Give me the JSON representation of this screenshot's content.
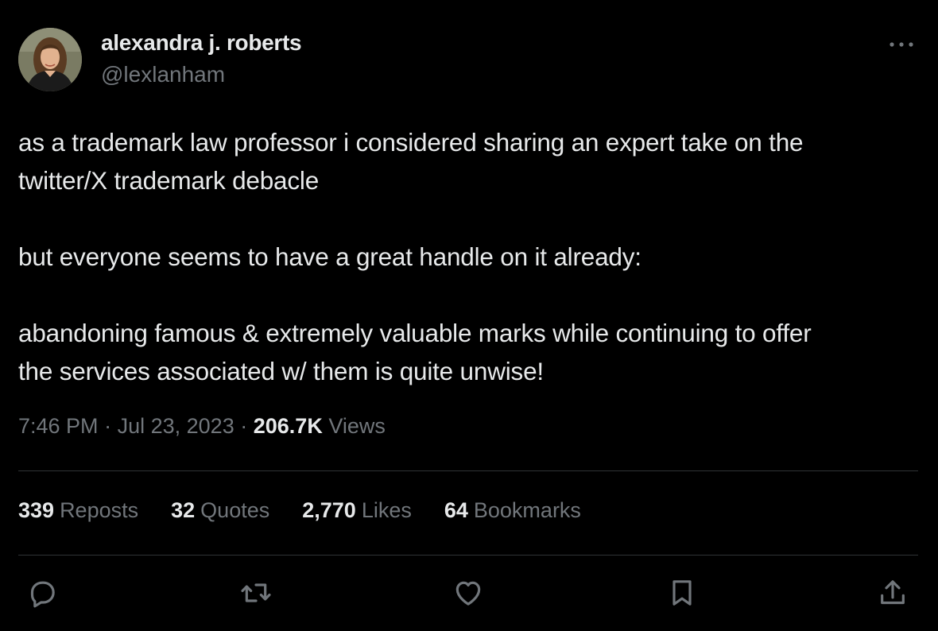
{
  "author": {
    "display_name": "alexandra j. roberts",
    "handle": "@lexlanham",
    "avatar_icon": "profile-photo"
  },
  "tweet": {
    "paragraphs": [
      [
        "as a trademark law professor i considered sharing an expert take on the",
        "twitter/X trademark debacle"
      ],
      [
        "but everyone seems to have a great handle on it already:"
      ],
      [
        "abandoning famous & extremely valuable marks while continuing to offer",
        "the services associated w/ them is quite unwise!"
      ]
    ]
  },
  "meta": {
    "time": "7:46 PM",
    "separator": "·",
    "date": "Jul 23, 2023",
    "views_count": "206.7K",
    "views_label": "Views"
  },
  "stats": {
    "reposts": {
      "count": "339",
      "label": "Reposts"
    },
    "quotes": {
      "count": "32",
      "label": "Quotes"
    },
    "likes": {
      "count": "2,770",
      "label": "Likes"
    },
    "bookmarks": {
      "count": "64",
      "label": "Bookmarks"
    }
  },
  "actions": [
    "reply-icon",
    "repost-icon",
    "like-icon",
    "bookmark-icon",
    "share-icon"
  ],
  "colors": {
    "background": "#000000",
    "text_primary": "#e7e9ea",
    "text_secondary": "#71767b",
    "divider": "#2f3336"
  }
}
